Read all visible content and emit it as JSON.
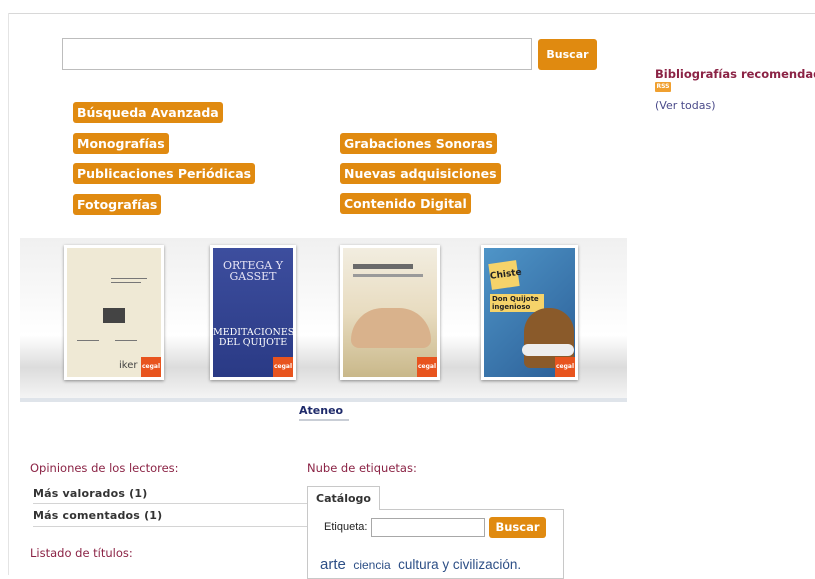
{
  "search": {
    "placeholder": "",
    "button_label": "Buscar"
  },
  "categories": [
    "Búsqueda Avanzada",
    "Monografías",
    "Publicaciones Periódicas",
    "Fotografías",
    "Grabaciones Sonoras",
    "Nuevas adquisiciones",
    "Contenido Digital"
  ],
  "recommended": {
    "title": "Bibliografías recomendadas",
    "rss_icon": "rss-icon",
    "see_all": "(Ver todas)"
  },
  "carousel": {
    "books": [
      {
        "cover_text": "iker",
        "badge": "cegal"
      },
      {
        "cover_title": "ORTEGA Y GASSET",
        "cover_subtitle": "MEDITACIONES DEL QUIJOTE",
        "badge": "cegal"
      },
      {
        "badge": "cegal"
      },
      {
        "cover_title": "Chiste",
        "cover_subtitle": "Don Quijote ingenioso",
        "badge": "cegal"
      }
    ],
    "tab": "Ateneo"
  },
  "opinions": {
    "title": "Opiniones de los lectores:",
    "items": [
      "Más valorados (1)",
      "Más comentados (1)"
    ]
  },
  "titles_list": {
    "title": "Listado de títulos:"
  },
  "tag_cloud": {
    "title": "Nube de etiquetas:",
    "tab": "Catálogo",
    "label": "Etiqueta:",
    "button_label": "Buscar",
    "tags": [
      "arte",
      "ciencia",
      "cultura y civilización."
    ]
  },
  "colors": {
    "accent": "#e08a10",
    "heading": "#8b2345",
    "link": "#2d4f86"
  }
}
